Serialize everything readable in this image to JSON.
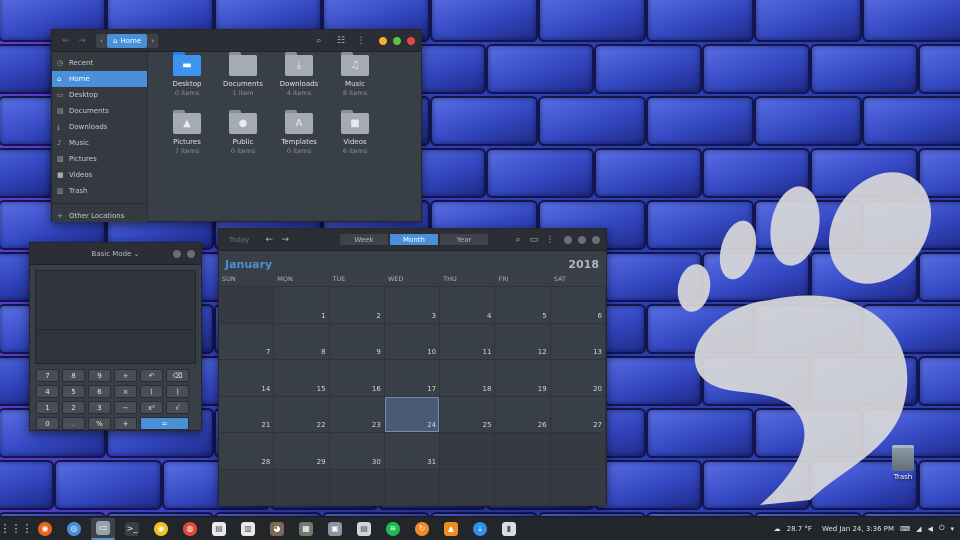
{
  "desktop": {
    "trash_label": "Trash"
  },
  "files": {
    "location": "Home",
    "sidebar": [
      {
        "label": "Recent",
        "icon": "clock-icon"
      },
      {
        "label": "Home",
        "icon": "home-icon",
        "active": true
      },
      {
        "label": "Desktop",
        "icon": "desktop-icon"
      },
      {
        "label": "Documents",
        "icon": "document-icon"
      },
      {
        "label": "Downloads",
        "icon": "download-icon"
      },
      {
        "label": "Music",
        "icon": "music-icon"
      },
      {
        "label": "Pictures",
        "icon": "picture-icon"
      },
      {
        "label": "Videos",
        "icon": "video-icon"
      },
      {
        "label": "Trash",
        "icon": "trash-icon"
      }
    ],
    "other_locations": "Other Locations",
    "folders": [
      {
        "name": "Desktop",
        "count": "0 items",
        "glyph": "▬",
        "blue": true
      },
      {
        "name": "Documents",
        "count": "1 item",
        "glyph": ""
      },
      {
        "name": "Downloads",
        "count": "4 items",
        "glyph": "⤓"
      },
      {
        "name": "Music",
        "count": "8 items",
        "glyph": "♫"
      },
      {
        "name": "Pictures",
        "count": "7 items",
        "glyph": "▲"
      },
      {
        "name": "Public",
        "count": "0 items",
        "glyph": "●"
      },
      {
        "name": "Templates",
        "count": "0 items",
        "glyph": "A"
      },
      {
        "name": "Videos",
        "count": "6 items",
        "glyph": "■"
      }
    ]
  },
  "calculator": {
    "mode": "Basic Mode",
    "keys": [
      "7",
      "8",
      "9",
      "÷",
      "↶",
      "⌫",
      "4",
      "5",
      "6",
      "×",
      "(",
      ")",
      "1",
      "2",
      "3",
      "−",
      "x²",
      "√",
      "0",
      ".",
      "%",
      "+",
      "="
    ]
  },
  "calendar": {
    "today_btn": "Today",
    "views": [
      "Week",
      "Month",
      "Year"
    ],
    "active_view": "Month",
    "month": "January",
    "year": "2018",
    "weekdays": [
      "SUN",
      "MON",
      "TUE",
      "WED",
      "THU",
      "FRI",
      "SAT"
    ],
    "lead_blank": 1,
    "days_in_month": 31,
    "today": 24
  },
  "tray": {
    "weather": "28.7 °F",
    "clock": "Wed Jan 24,  3:36 PM"
  },
  "taskbar_apps": [
    {
      "name": "firefox",
      "color": "#e8631b"
    },
    {
      "name": "chromium",
      "color": "#4a8fd8"
    },
    {
      "name": "files",
      "color": "#9aa3ad",
      "active": true
    },
    {
      "name": "terminal",
      "color": "#3a3f45"
    },
    {
      "name": "rhythmbox",
      "color": "#f0c020"
    },
    {
      "name": "google-chrome",
      "color": "#de4b3d"
    },
    {
      "name": "text-editor",
      "color": "#e7e9ec"
    },
    {
      "name": "document-viewer",
      "color": "#e9e9e9"
    },
    {
      "name": "gimp",
      "color": "#7a6a52"
    },
    {
      "name": "calculator",
      "color": "#6c7b6b"
    },
    {
      "name": "screenshot",
      "color": "#8a97a3"
    },
    {
      "name": "system-monitor",
      "color": "#cfd5da"
    },
    {
      "name": "spotify",
      "color": "#1db954"
    },
    {
      "name": "software-update",
      "color": "#f08a24"
    },
    {
      "name": "vlc",
      "color": "#f28c1c"
    },
    {
      "name": "installer",
      "color": "#2f8ee8"
    },
    {
      "name": "terminal-2",
      "color": "#d9dde2"
    }
  ]
}
